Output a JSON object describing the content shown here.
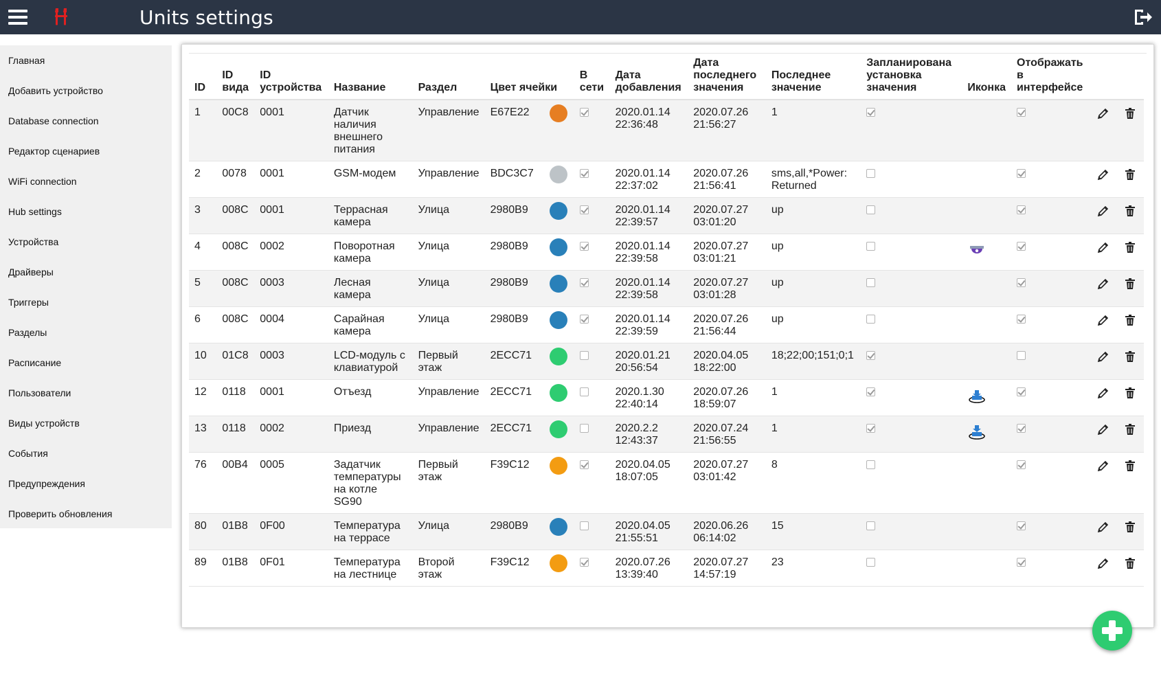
{
  "header": {
    "title": "Units settings"
  },
  "sidebar": {
    "items": [
      {
        "label": "Главная"
      },
      {
        "label": "Добавить устройство"
      },
      {
        "label": "Database connection"
      },
      {
        "label": "Редактор сценариев"
      },
      {
        "label": "WiFi connection"
      },
      {
        "label": "Hub settings"
      },
      {
        "label": "Устройства"
      },
      {
        "label": "Драйверы"
      },
      {
        "label": "Триггеры"
      },
      {
        "label": "Разделы"
      },
      {
        "label": "Расписание"
      },
      {
        "label": "Пользователи"
      },
      {
        "label": "Виды устройств"
      },
      {
        "label": "События"
      },
      {
        "label": "Предупреждения"
      },
      {
        "label": "Проверить обновления"
      }
    ]
  },
  "table": {
    "columns": {
      "id": "ID",
      "type_id": "ID вида",
      "device_id": "ID устройства",
      "name": "Название",
      "section": "Раздел",
      "color": "Цвет ячейки",
      "online": "В сети",
      "added": "Дата добавления",
      "last_date": "Дата последнего значения",
      "last_value": "Последнее значение",
      "scheduled": "Запланирована установка значения",
      "icon": "Иконка",
      "show": "Отображать в интерфейсе"
    },
    "rows": [
      {
        "id": "1",
        "type_id": "00C8",
        "device_id": "0001",
        "name": "Датчик наличия внешнего питания",
        "section": "Управление",
        "color": "E67E22",
        "color_hex": "#e67e22",
        "online": true,
        "added": "2020.01.14 22:36:48",
        "last_date": "2020.07.26 21:56:27",
        "last_value": "1",
        "scheduled": true,
        "icon": "",
        "show": true
      },
      {
        "id": "2",
        "type_id": "0078",
        "device_id": "0001",
        "name": "GSM-модем",
        "section": "Управление",
        "color": "BDC3C7",
        "color_hex": "#bdc3c7",
        "online": true,
        "added": "2020.01.14 22:37:02",
        "last_date": "2020.07.26 21:56:41",
        "last_value": "sms,all,*Power: Returned",
        "scheduled": false,
        "icon": "",
        "show": true
      },
      {
        "id": "3",
        "type_id": "008C",
        "device_id": "0001",
        "name": "Террасная камера",
        "section": "Улица",
        "color": "2980B9",
        "color_hex": "#2980b9",
        "online": true,
        "added": "2020.01.14 22:39:57",
        "last_date": "2020.07.27 03:01:20",
        "last_value": "up",
        "scheduled": false,
        "icon": "",
        "show": true
      },
      {
        "id": "4",
        "type_id": "008C",
        "device_id": "0002",
        "name": "Поворотная камера",
        "section": "Улица",
        "color": "2980B9",
        "color_hex": "#2980b9",
        "online": true,
        "added": "2020.01.14 22:39:58",
        "last_date": "2020.07.27 03:01:21",
        "last_value": "up",
        "scheduled": false,
        "icon": "dome-camera-icon",
        "show": true
      },
      {
        "id": "5",
        "type_id": "008C",
        "device_id": "0003",
        "name": "Лесная камера",
        "section": "Улица",
        "color": "2980B9",
        "color_hex": "#2980b9",
        "online": true,
        "added": "2020.01.14 22:39:58",
        "last_date": "2020.07.27 03:01:28",
        "last_value": "up",
        "scheduled": false,
        "icon": "",
        "show": true
      },
      {
        "id": "6",
        "type_id": "008C",
        "device_id": "0004",
        "name": "Сарайная камера",
        "section": "Улица",
        "color": "2980B9",
        "color_hex": "#2980b9",
        "online": true,
        "added": "2020.01.14 22:39:59",
        "last_date": "2020.07.26 21:56:44",
        "last_value": "up",
        "scheduled": false,
        "icon": "",
        "show": true
      },
      {
        "id": "10",
        "type_id": "01C8",
        "device_id": "0003",
        "name": "LCD-модуль с клавиатурой",
        "section": "Первый этаж",
        "color": "2ECC71",
        "color_hex": "#2ecc71",
        "online": false,
        "added": "2020.01.21 20:56:54",
        "last_date": "2020.04.05 18:22:00",
        "last_value": "18;22;00;151;0;1",
        "scheduled": true,
        "icon": "",
        "show": false
      },
      {
        "id": "12",
        "type_id": "0118",
        "device_id": "0001",
        "name": "Отъезд",
        "section": "Управление",
        "color": "2ECC71",
        "color_hex": "#2ecc71",
        "online": false,
        "added": "2020.1.30 22:40:14",
        "last_date": "2020.07.26 18:59:07",
        "last_value": "1",
        "scheduled": true,
        "icon": "departure-icon",
        "show": true
      },
      {
        "id": "13",
        "type_id": "0118",
        "device_id": "0002",
        "name": "Приезд",
        "section": "Управление",
        "color": "2ECC71",
        "color_hex": "#2ecc71",
        "online": false,
        "added": "2020.2.2 12:43:37",
        "last_date": "2020.07.24 21:56:55",
        "last_value": "1",
        "scheduled": true,
        "icon": "arrival-icon",
        "show": true
      },
      {
        "id": "76",
        "type_id": "00B4",
        "device_id": "0005",
        "name": "Задатчик температуры на котле SG90",
        "section": "Первый этаж",
        "color": "F39C12",
        "color_hex": "#f39c12",
        "online": true,
        "added": "2020.04.05 18:07:05",
        "last_date": "2020.07.27 03:01:42",
        "last_value": "8",
        "scheduled": false,
        "icon": "",
        "show": true
      },
      {
        "id": "80",
        "type_id": "01B8",
        "device_id": "0F00",
        "name": "Температура на террасе",
        "section": "Улица",
        "color": "2980B9",
        "color_hex": "#2980b9",
        "online": false,
        "added": "2020.04.05 21:55:51",
        "last_date": "2020.06.26 06:14:02",
        "last_value": "15",
        "scheduled": false,
        "icon": "",
        "show": true
      },
      {
        "id": "89",
        "type_id": "01B8",
        "device_id": "0F01",
        "name": "Температура на лестнице",
        "section": "Второй этаж",
        "color": "F39C12",
        "color_hex": "#f39c12",
        "online": true,
        "added": "2020.07.26 13:39:40",
        "last_date": "2020.07.27 14:57:19",
        "last_value": "23",
        "scheduled": false,
        "icon": "",
        "show": true
      }
    ]
  },
  "icons": {
    "menu": "hamburger-menu-icon",
    "logo": "wrench-logo-icon",
    "logout": "logout-icon",
    "edit": "pencil-icon",
    "delete": "trash-icon",
    "add": "plus-icon"
  },
  "colors": {
    "header_bg": "#2b3545",
    "logo": "#e02020",
    "add_button": "#2ecc71"
  }
}
